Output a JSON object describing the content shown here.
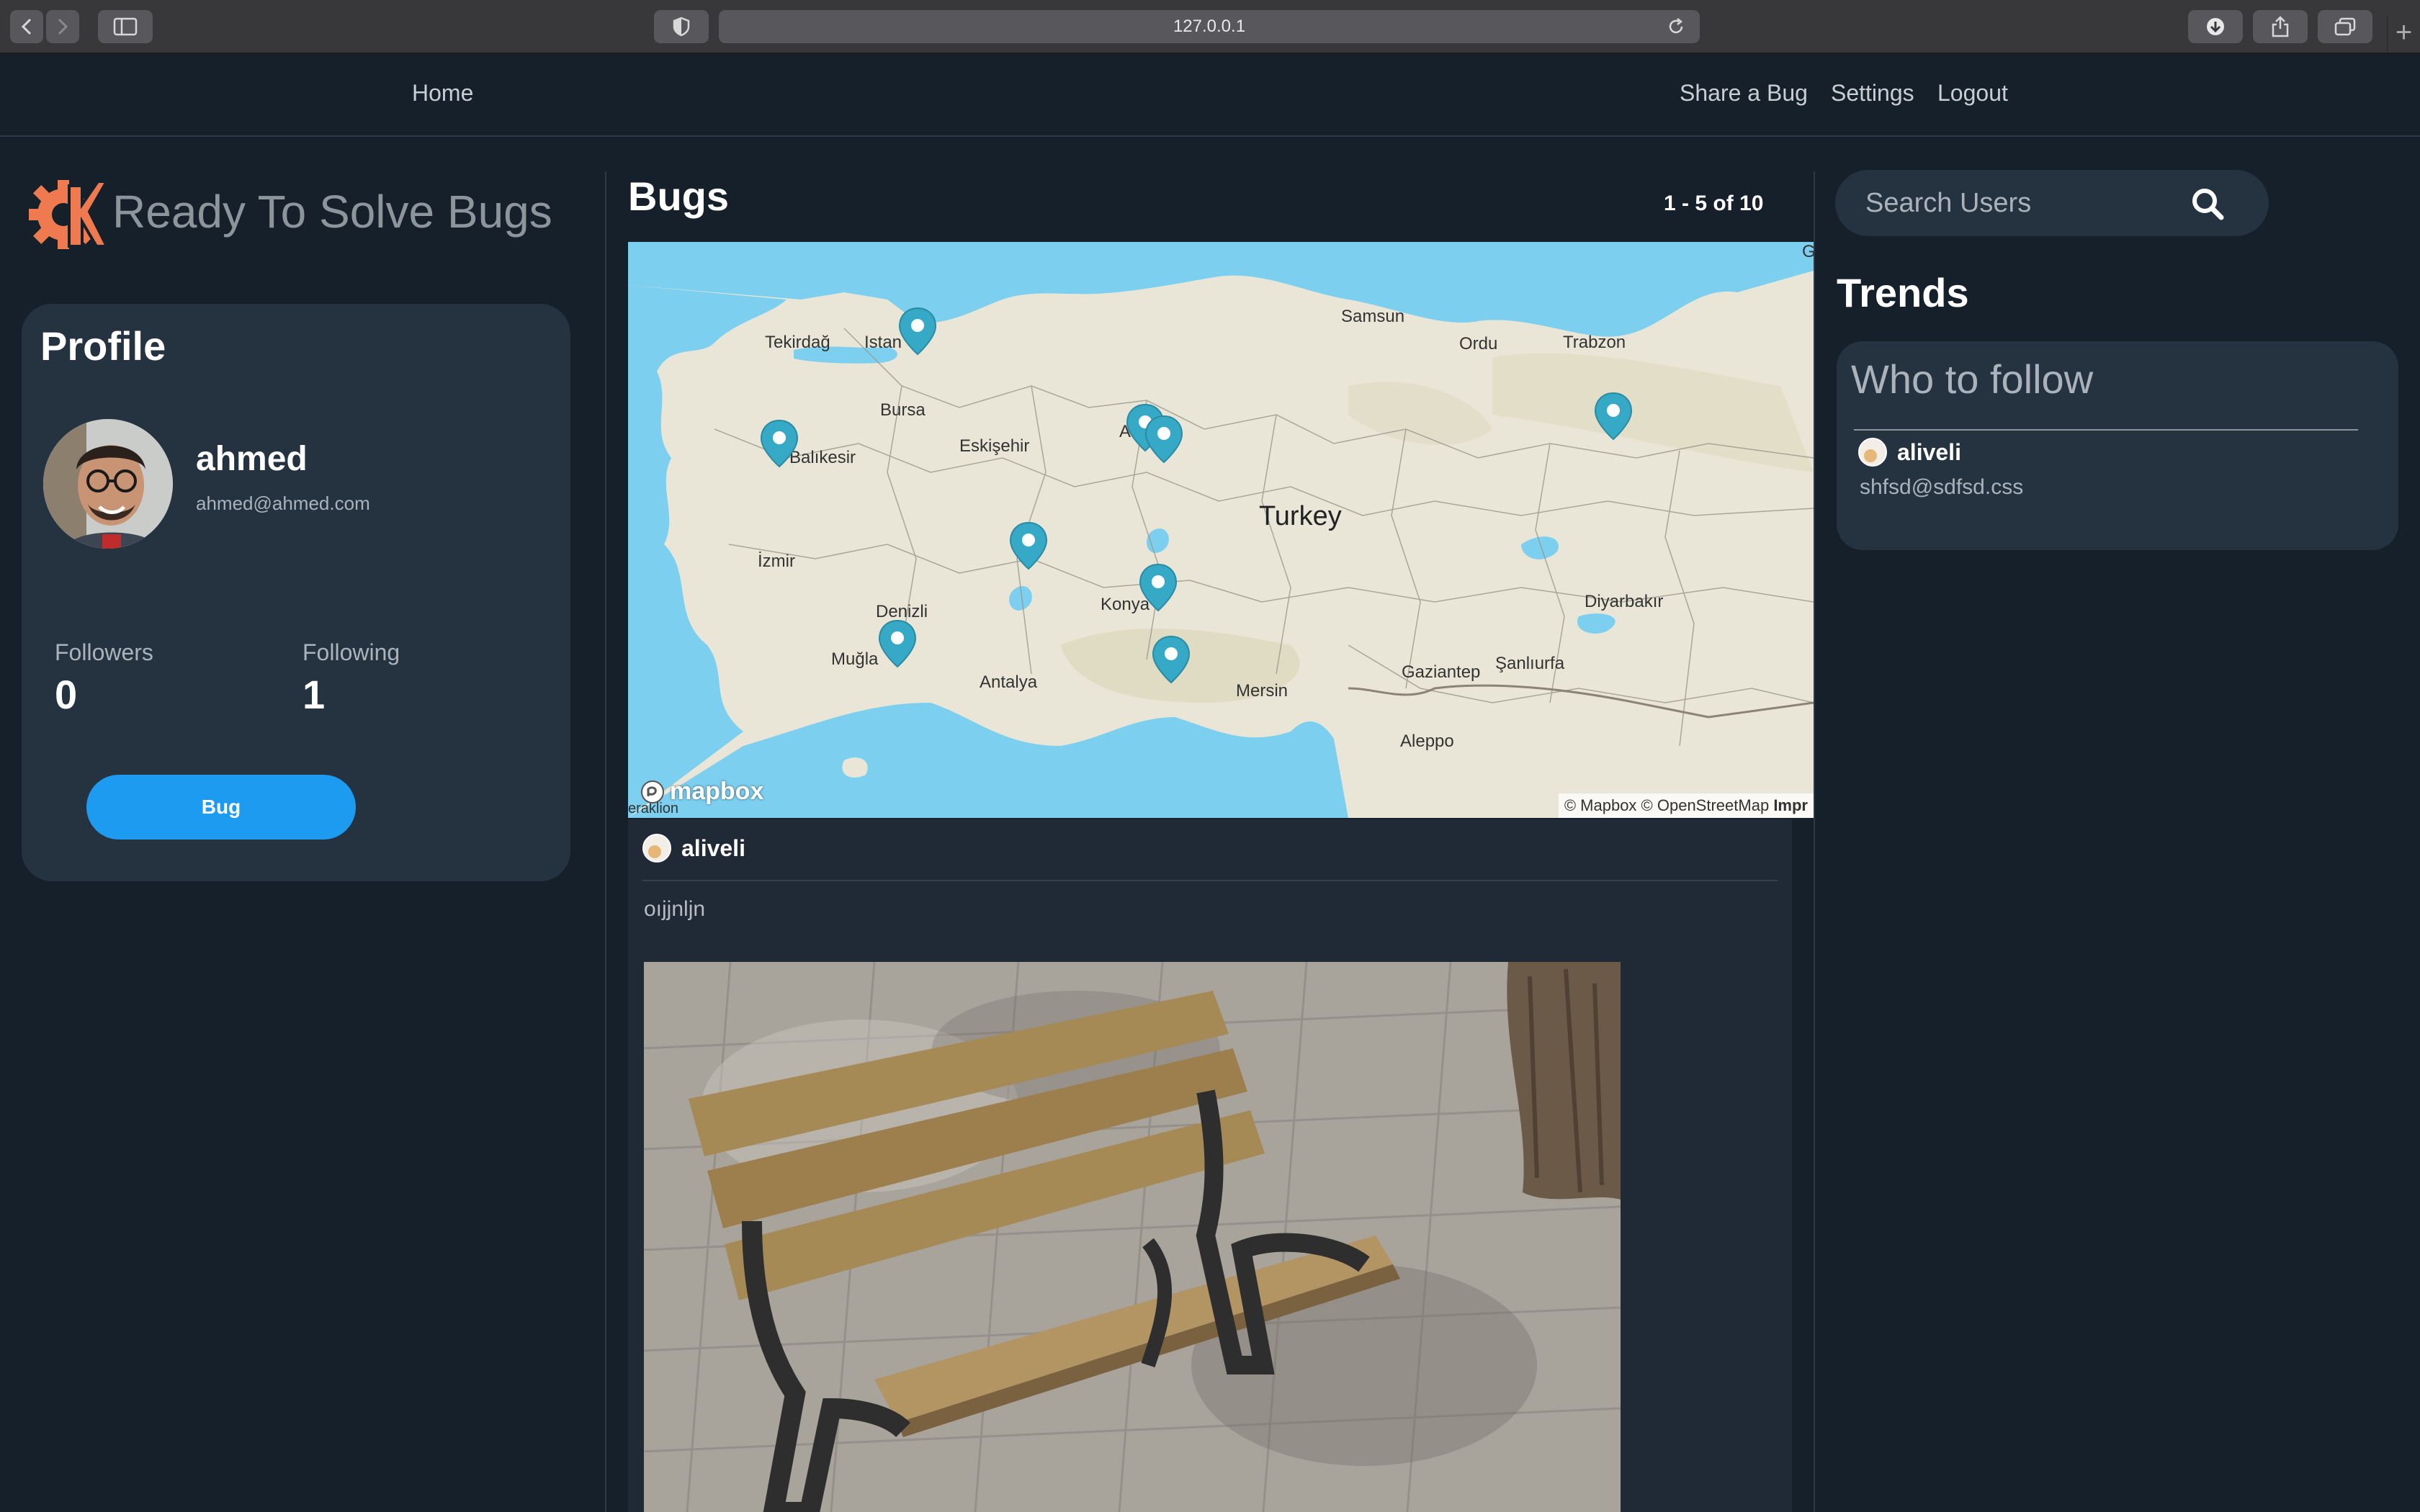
{
  "browser": {
    "url": "127.0.0.1"
  },
  "nav": {
    "home": "Home",
    "share": "Share a Bug",
    "settings": "Settings",
    "logout": "Logout"
  },
  "brand": {
    "title": "Ready To Solve Bugs",
    "logo_color": "#f07a4f"
  },
  "profile": {
    "title": "Profile",
    "name": "ahmed",
    "email": "ahmed@ahmed.com",
    "followers_label": "Followers",
    "followers": "0",
    "following_label": "Following",
    "following": "1",
    "bug_button": "Bug"
  },
  "feed": {
    "title": "Bugs",
    "pager": "1 - 5 of 10"
  },
  "map": {
    "country": "Turkey",
    "cities": [
      "Tekirdağ",
      "Istan",
      "Bursa",
      "Balıkesir",
      "Eskişehir",
      "Ankara",
      "Samsun",
      "Ordu",
      "Trabzon",
      "İzmir",
      "Denizli",
      "Muğla",
      "Antalya",
      "Konya",
      "Mersin",
      "Gaziantep",
      "Şanlıurfa",
      "Diyarbakır",
      "Aleppo",
      "eraklion",
      "G"
    ],
    "logo": "mapbox",
    "attribution": "© Mapbox © OpenStreetMap",
    "attribution_extra": "Impr",
    "pin_color": "#35a9c5",
    "pin_count": 9
  },
  "post": {
    "user": "aliveli",
    "text": "oıjjnljn"
  },
  "sidebar": {
    "search_placeholder": "Search Users",
    "trends_title": "Trends",
    "who_to_follow": "Who to follow",
    "suggestion_name": "aliveli",
    "suggestion_email": "shfsd@sdfsd.css"
  },
  "colors": {
    "background": "#15202b",
    "card": "#253341",
    "accent": "#1d9bf0"
  }
}
